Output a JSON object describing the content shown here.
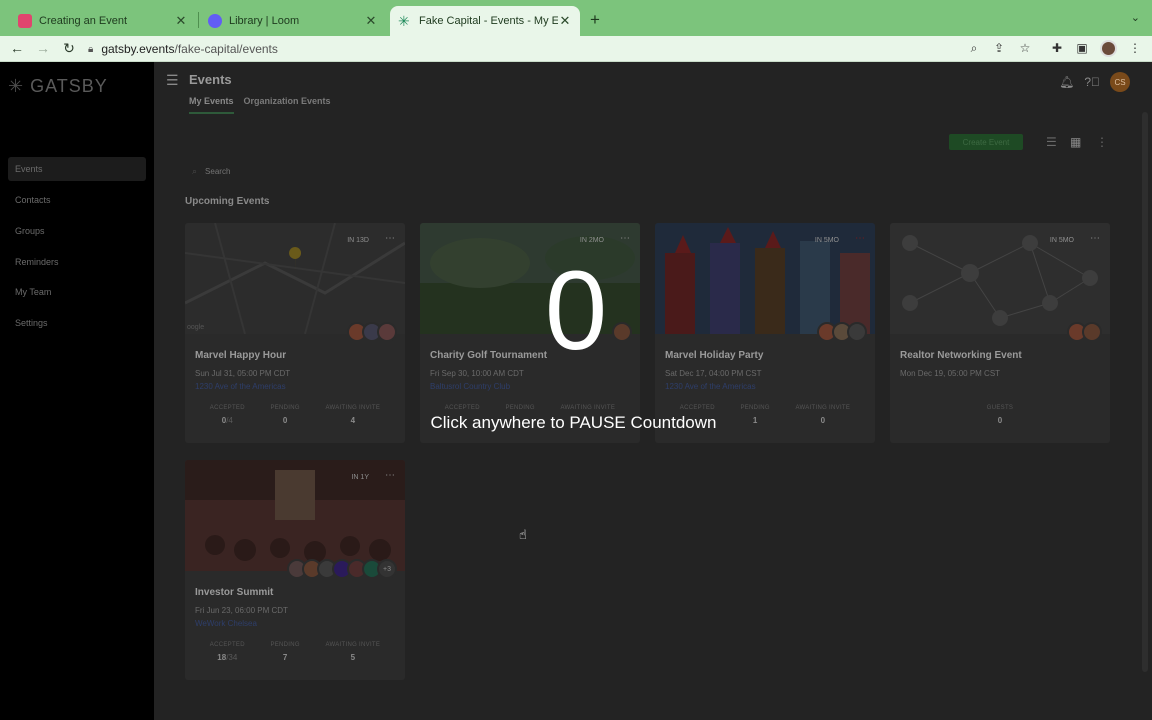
{
  "browser": {
    "tabs": [
      {
        "title": "Creating an Event",
        "favicon_color": "#e0456e"
      },
      {
        "title": "Library | Loom",
        "favicon_color": "#625df5"
      },
      {
        "title": "Fake Capital - Events - My Eve",
        "favicon_color": "#1e8a5a",
        "active": true
      }
    ],
    "url_host": "gatsby.events",
    "url_path": "/fake-capital/events"
  },
  "sidebar": {
    "logo": "GATSBY",
    "items": [
      {
        "label": "Events",
        "active": true
      },
      {
        "label": "Contacts"
      },
      {
        "label": "Groups"
      },
      {
        "label": "Reminders"
      },
      {
        "label": "My Team"
      },
      {
        "label": "Settings"
      }
    ]
  },
  "header": {
    "title": "Events",
    "avatar_initials": "CS",
    "tabs": [
      {
        "label": "My Events",
        "active": true
      },
      {
        "label": "Organization Events"
      }
    ],
    "create_label": "Create Event"
  },
  "search": {
    "placeholder": "Search"
  },
  "section_title": "Upcoming Events",
  "events": [
    {
      "name": "Marvel Happy Hour",
      "when": "IN 13D",
      "date": "Sun Jul 31, 05:00 PM CDT",
      "location": "1230 Ave of the Americas",
      "stats": [
        {
          "label": "ACCEPTED",
          "value": "0",
          "sub": "/4"
        },
        {
          "label": "PENDING",
          "value": "0"
        },
        {
          "label": "AWAITING INVITE",
          "value": "4"
        }
      ]
    },
    {
      "name": "Charity Golf Tournament",
      "when": "IN 2MO",
      "date": "Fri Sep 30, 10:00 AM CDT",
      "location": "Baltusrol Country Club",
      "stats": [
        {
          "label": "ACCEPTED",
          "value": ""
        },
        {
          "label": "PENDING",
          "value": ""
        },
        {
          "label": "AWAITING INVITE",
          "value": ""
        }
      ]
    },
    {
      "name": "Marvel Holiday Party",
      "when": "IN 5MO",
      "date": "Sat Dec 17, 04:00 PM CST",
      "location": "1230 Ave of the Americas",
      "stats": [
        {
          "label": "ACCEPTED",
          "value": ""
        },
        {
          "label": "PENDING",
          "value": "1"
        },
        {
          "label": "AWAITING INVITE",
          "value": "0"
        }
      ]
    },
    {
      "name": "Realtor Networking Event",
      "when": "IN 5MO",
      "date": "Mon Dec 19, 05:00 PM CST",
      "location": "",
      "stats": [
        {
          "label": "GUESTS",
          "value": "0"
        }
      ]
    },
    {
      "name": "Investor Summit",
      "when": "IN 1Y",
      "date": "Fri Jun 23, 06:00 PM CDT",
      "location": "WeWork Chelsea",
      "extra_guests": "+3",
      "stats": [
        {
          "label": "ACCEPTED",
          "value": "18",
          "sub": "/34"
        },
        {
          "label": "PENDING",
          "value": "7"
        },
        {
          "label": "AWAITING INVITE",
          "value": "5"
        }
      ]
    }
  ],
  "overlay": {
    "countdown": "0",
    "hint": "Click anywhere to PAUSE Countdown"
  }
}
